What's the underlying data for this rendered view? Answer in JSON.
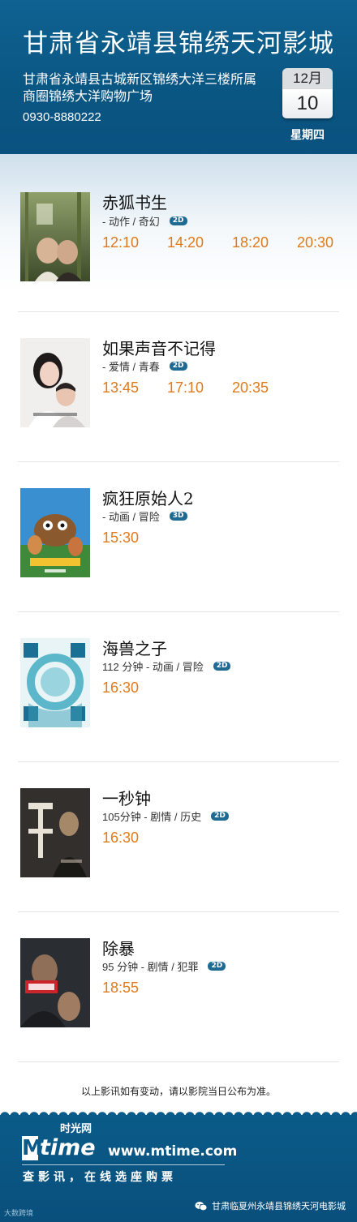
{
  "header": {
    "cinema_name": "甘肃省永靖县锦绣天河影城",
    "address_line1": "甘肃省永靖县古城新区锦绣大洋三楼所属",
    "address_line2": "商圈锦绣大洋购物广场",
    "phone": "0930-8880222",
    "calendar_month": "12月",
    "calendar_day": "10",
    "weekday": "星期四"
  },
  "movies": [
    {
      "title": "赤狐书生",
      "meta": "- 动作 / 奇幻",
      "format": "2D",
      "showtimes": [
        "12:10",
        "14:20",
        "18:20",
        "20:30"
      ]
    },
    {
      "title": "如果声音不记得",
      "meta": "- 爱情 / 青春",
      "format": "2D",
      "showtimes": [
        "13:45",
        "17:10",
        "20:35"
      ]
    },
    {
      "title": "疯狂原始人2",
      "meta": "- 动画 / 冒险",
      "format": "3D",
      "showtimes": [
        "15:30"
      ]
    },
    {
      "title": "海兽之子",
      "meta": "112 分钟 - 动画 / 冒险",
      "format": "2D",
      "showtimes": [
        "16:30"
      ]
    },
    {
      "title": "一秒钟",
      "meta": "105分钟 - 剧情 / 历史",
      "format": "2D",
      "showtimes": [
        "16:30"
      ]
    },
    {
      "title": "除暴",
      "meta": "95 分钟 - 剧情 / 犯罪",
      "format": "2D",
      "showtimes": [
        "18:55"
      ]
    }
  ],
  "notice": "以上影讯如有变动，请以影院当日公布为准。",
  "footer": {
    "logo_m": "M",
    "logo_word": "time",
    "logo_cn": "时光网",
    "url": "www.mtime.com",
    "slogan": "查影讯，在线选座购票",
    "wechat_account": "甘肃临夏州永靖县锦绣天河电影城",
    "watermark": "大数跨境"
  },
  "colors": {
    "header_blue": "#0a5683",
    "showtime_orange": "#e07a1a",
    "badge_blue": "#1e6a93"
  }
}
